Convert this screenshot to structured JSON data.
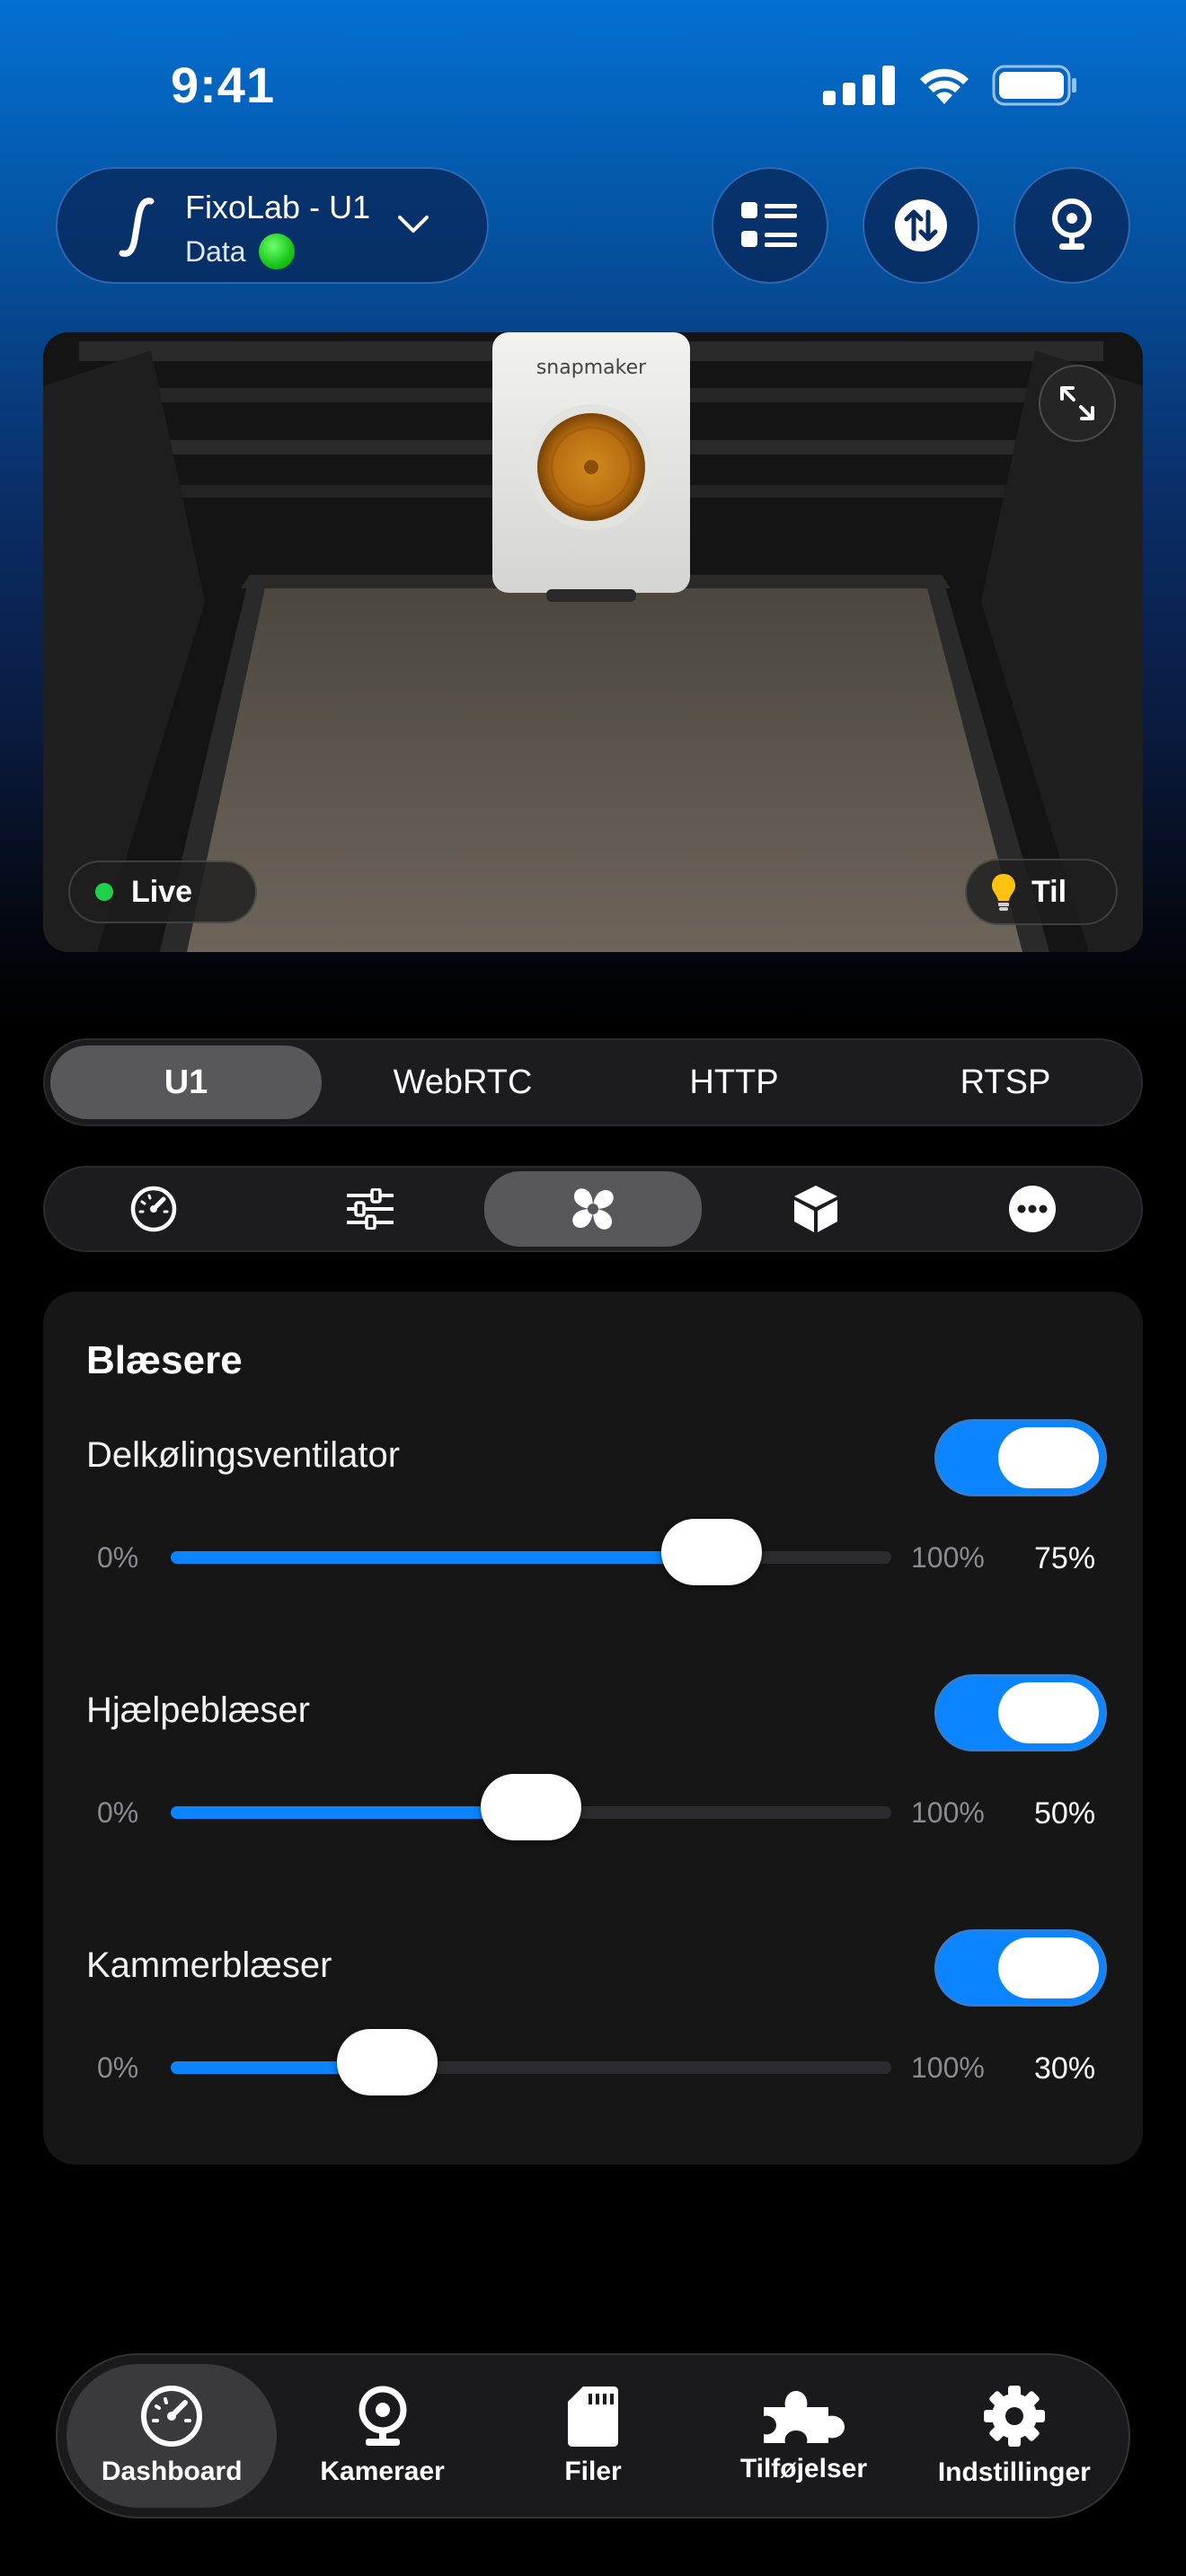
{
  "status": {
    "time": "9:41"
  },
  "header": {
    "printer_name": "FixoLab - U1",
    "printer_status": "Data"
  },
  "camera": {
    "live_label": "Live",
    "light_label": "Til",
    "brand_text": "snapmaker"
  },
  "streams": [
    "U1",
    "WebRTC",
    "HTTP",
    "RTSP"
  ],
  "sections": {
    "icons": [
      "dashboard-gauge-icon",
      "sliders-icon",
      "fan-icon",
      "cube-icon",
      "more-icon"
    ],
    "active_index": 2
  },
  "fans": {
    "title": "Blæsere",
    "min_label": "0%",
    "max_label": "100%",
    "items": [
      {
        "name": "Delkølingsventilator",
        "enabled": true,
        "value": 75,
        "value_label": "75%"
      },
      {
        "name": "Hjælpeblæser",
        "enabled": true,
        "value": 50,
        "value_label": "50%"
      },
      {
        "name": "Kammerblæser",
        "enabled": true,
        "value": 30,
        "value_label": "30%"
      }
    ]
  },
  "tabbar": {
    "items": [
      {
        "label": "Dashboard",
        "icon": "gauge-icon"
      },
      {
        "label": "Kameraer",
        "icon": "webcam-icon"
      },
      {
        "label": "Filer",
        "icon": "sd-card-icon"
      },
      {
        "label": "Tilføjelser",
        "icon": "puzzle-icon"
      },
      {
        "label": "Indstillinger",
        "icon": "gear-icon"
      }
    ],
    "active_index": 0
  },
  "colors": {
    "accent": "#0a84ff",
    "status_online": "#1fd14a"
  }
}
